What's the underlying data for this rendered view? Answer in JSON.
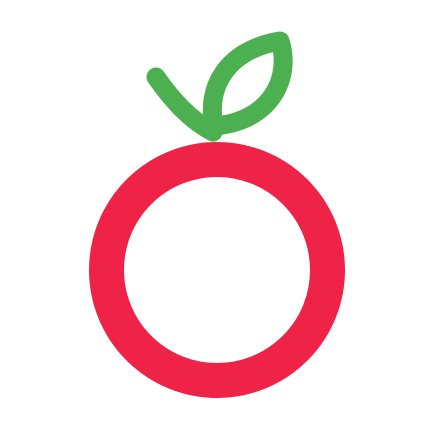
{
  "logo": {
    "icon": "apple-ring-with-leaf-icon",
    "colors": {
      "background": "#ffffff",
      "ring": "#EE2347",
      "leaf": "#4CAF50"
    }
  }
}
